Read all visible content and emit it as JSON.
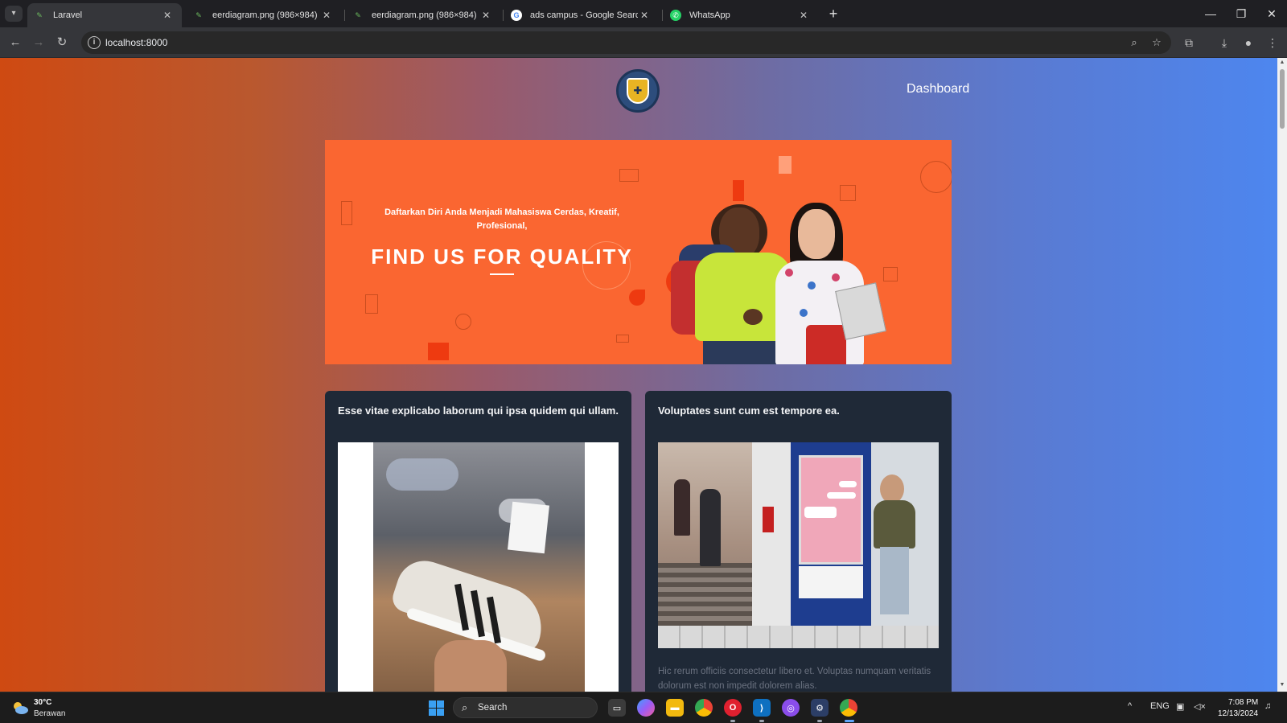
{
  "browser": {
    "tabs": [
      {
        "title": "Laravel",
        "active": true
      },
      {
        "title": "eerdiagram.png (986×984)",
        "active": false
      },
      {
        "title": "eerdiagram.png (986×984)",
        "active": false
      },
      {
        "title": "ads campus - Google Search",
        "active": false
      },
      {
        "title": "WhatsApp",
        "active": false
      }
    ],
    "url": "localhost:8000"
  },
  "page": {
    "nav": {
      "dashboard_label": "Dashboard"
    },
    "banner": {
      "tagline": "Daftarkan Diri Anda Menjadi Mahasiswa Cerdas, Kreatif, Profesional,",
      "headline": "FIND US FOR QUALITY",
      "color": "#fa6631"
    },
    "cards": [
      {
        "title": "Esse vitae explicabo laborum qui ipsa quidem qui ullam.",
        "image": "sneaker-photo",
        "description": ""
      },
      {
        "title": "Voluptates sunt cum est tempore ea.",
        "image": "campus-hallway-photo",
        "description": "Hic rerum officiis consectetur libero et. Voluptas numquam veritatis dolorum est non impedit dolorem alias."
      }
    ]
  },
  "taskbar": {
    "weather_temp": "30°C",
    "weather_desc": "Berawan",
    "search_label": "Search",
    "language": "ENG",
    "time": "7:08 PM",
    "date": "12/13/2024"
  }
}
